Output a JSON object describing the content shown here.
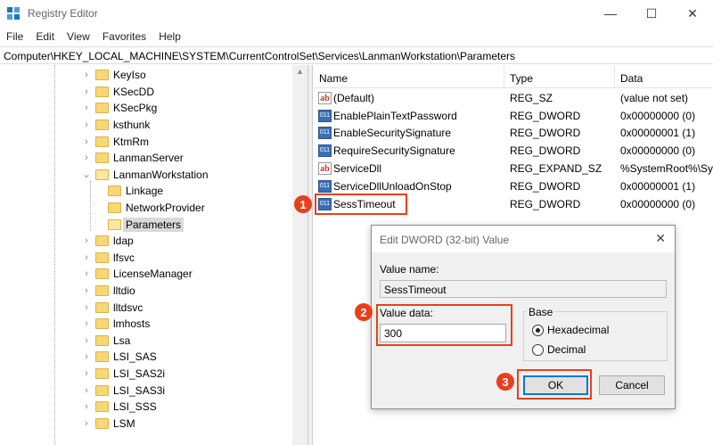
{
  "window": {
    "title": "Registry Editor",
    "minimize_glyph": "—",
    "maximize_glyph": "☐",
    "close_glyph": "✕"
  },
  "menu": [
    "File",
    "Edit",
    "View",
    "Favorites",
    "Help"
  ],
  "address": "Computer\\HKEY_LOCAL_MACHINE\\SYSTEM\\CurrentControlSet\\Services\\LanmanWorkstation\\Parameters",
  "tree": {
    "items": [
      {
        "label": "KeyIso",
        "expandable": true
      },
      {
        "label": "KSecDD",
        "expandable": true
      },
      {
        "label": "KSecPkg",
        "expandable": true
      },
      {
        "label": "ksthunk",
        "expandable": true
      },
      {
        "label": "KtmRm",
        "expandable": true
      },
      {
        "label": "LanmanServer",
        "expandable": true
      },
      {
        "label": "LanmanWorkstation",
        "expandable": true,
        "expanded": true
      },
      {
        "label": "Linkage",
        "child": true
      },
      {
        "label": "NetworkProvider",
        "child": true
      },
      {
        "label": "Parameters",
        "child": true,
        "selected": true
      },
      {
        "label": "ldap",
        "expandable": true
      },
      {
        "label": "lfsvc",
        "expandable": true
      },
      {
        "label": "LicenseManager",
        "expandable": true
      },
      {
        "label": "lltdio",
        "expandable": true
      },
      {
        "label": "lltdsvc",
        "expandable": true
      },
      {
        "label": "lmhosts",
        "expandable": true
      },
      {
        "label": "Lsa",
        "expandable": true
      },
      {
        "label": "LSI_SAS",
        "expandable": true
      },
      {
        "label": "LSI_SAS2i",
        "expandable": true
      },
      {
        "label": "LSI_SAS3i",
        "expandable": true
      },
      {
        "label": "LSI_SSS",
        "expandable": true
      },
      {
        "label": "LSM",
        "expandable": true
      }
    ]
  },
  "list": {
    "columns": [
      "Name",
      "Type",
      "Data"
    ],
    "rows": [
      {
        "icon": "string-value-icon",
        "name": "(Default)",
        "type": "REG_SZ",
        "data": "(value not set)"
      },
      {
        "icon": "dword-value-icon",
        "name": "EnablePlainTextPassword",
        "type": "REG_DWORD",
        "data": "0x00000000 (0)"
      },
      {
        "icon": "dword-value-icon",
        "name": "EnableSecuritySignature",
        "type": "REG_DWORD",
        "data": "0x00000001 (1)"
      },
      {
        "icon": "dword-value-icon",
        "name": "RequireSecuritySignature",
        "type": "REG_DWORD",
        "data": "0x00000000 (0)"
      },
      {
        "icon": "string-value-icon",
        "name": "ServiceDll",
        "type": "REG_EXPAND_SZ",
        "data": "%SystemRoot%\\Sy"
      },
      {
        "icon": "dword-value-icon",
        "name": "ServiceDllUnloadOnStop",
        "type": "REG_DWORD",
        "data": "0x00000001 (1)"
      },
      {
        "icon": "dword-value-icon",
        "name": "SessTimeout",
        "type": "REG_DWORD",
        "data": "0x00000000 (0)"
      }
    ]
  },
  "icons": {
    "sz_glyph": "ab",
    "dword_glyph": "011"
  },
  "dialog": {
    "title": "Edit DWORD (32-bit) Value",
    "close_glyph": "✕",
    "value_name_label": "Value name:",
    "value_name": "SessTimeout",
    "value_data_label": "Value data:",
    "value_data": "300",
    "base_label": "Base",
    "base_options": [
      {
        "label": "Hexadecimal",
        "checked": true
      },
      {
        "label": "Decimal",
        "checked": false
      }
    ],
    "ok_label": "OK",
    "cancel_label": "Cancel"
  },
  "annotations": {
    "step1": "1",
    "step2": "2",
    "step3": "3",
    "color": "#e8401c"
  }
}
